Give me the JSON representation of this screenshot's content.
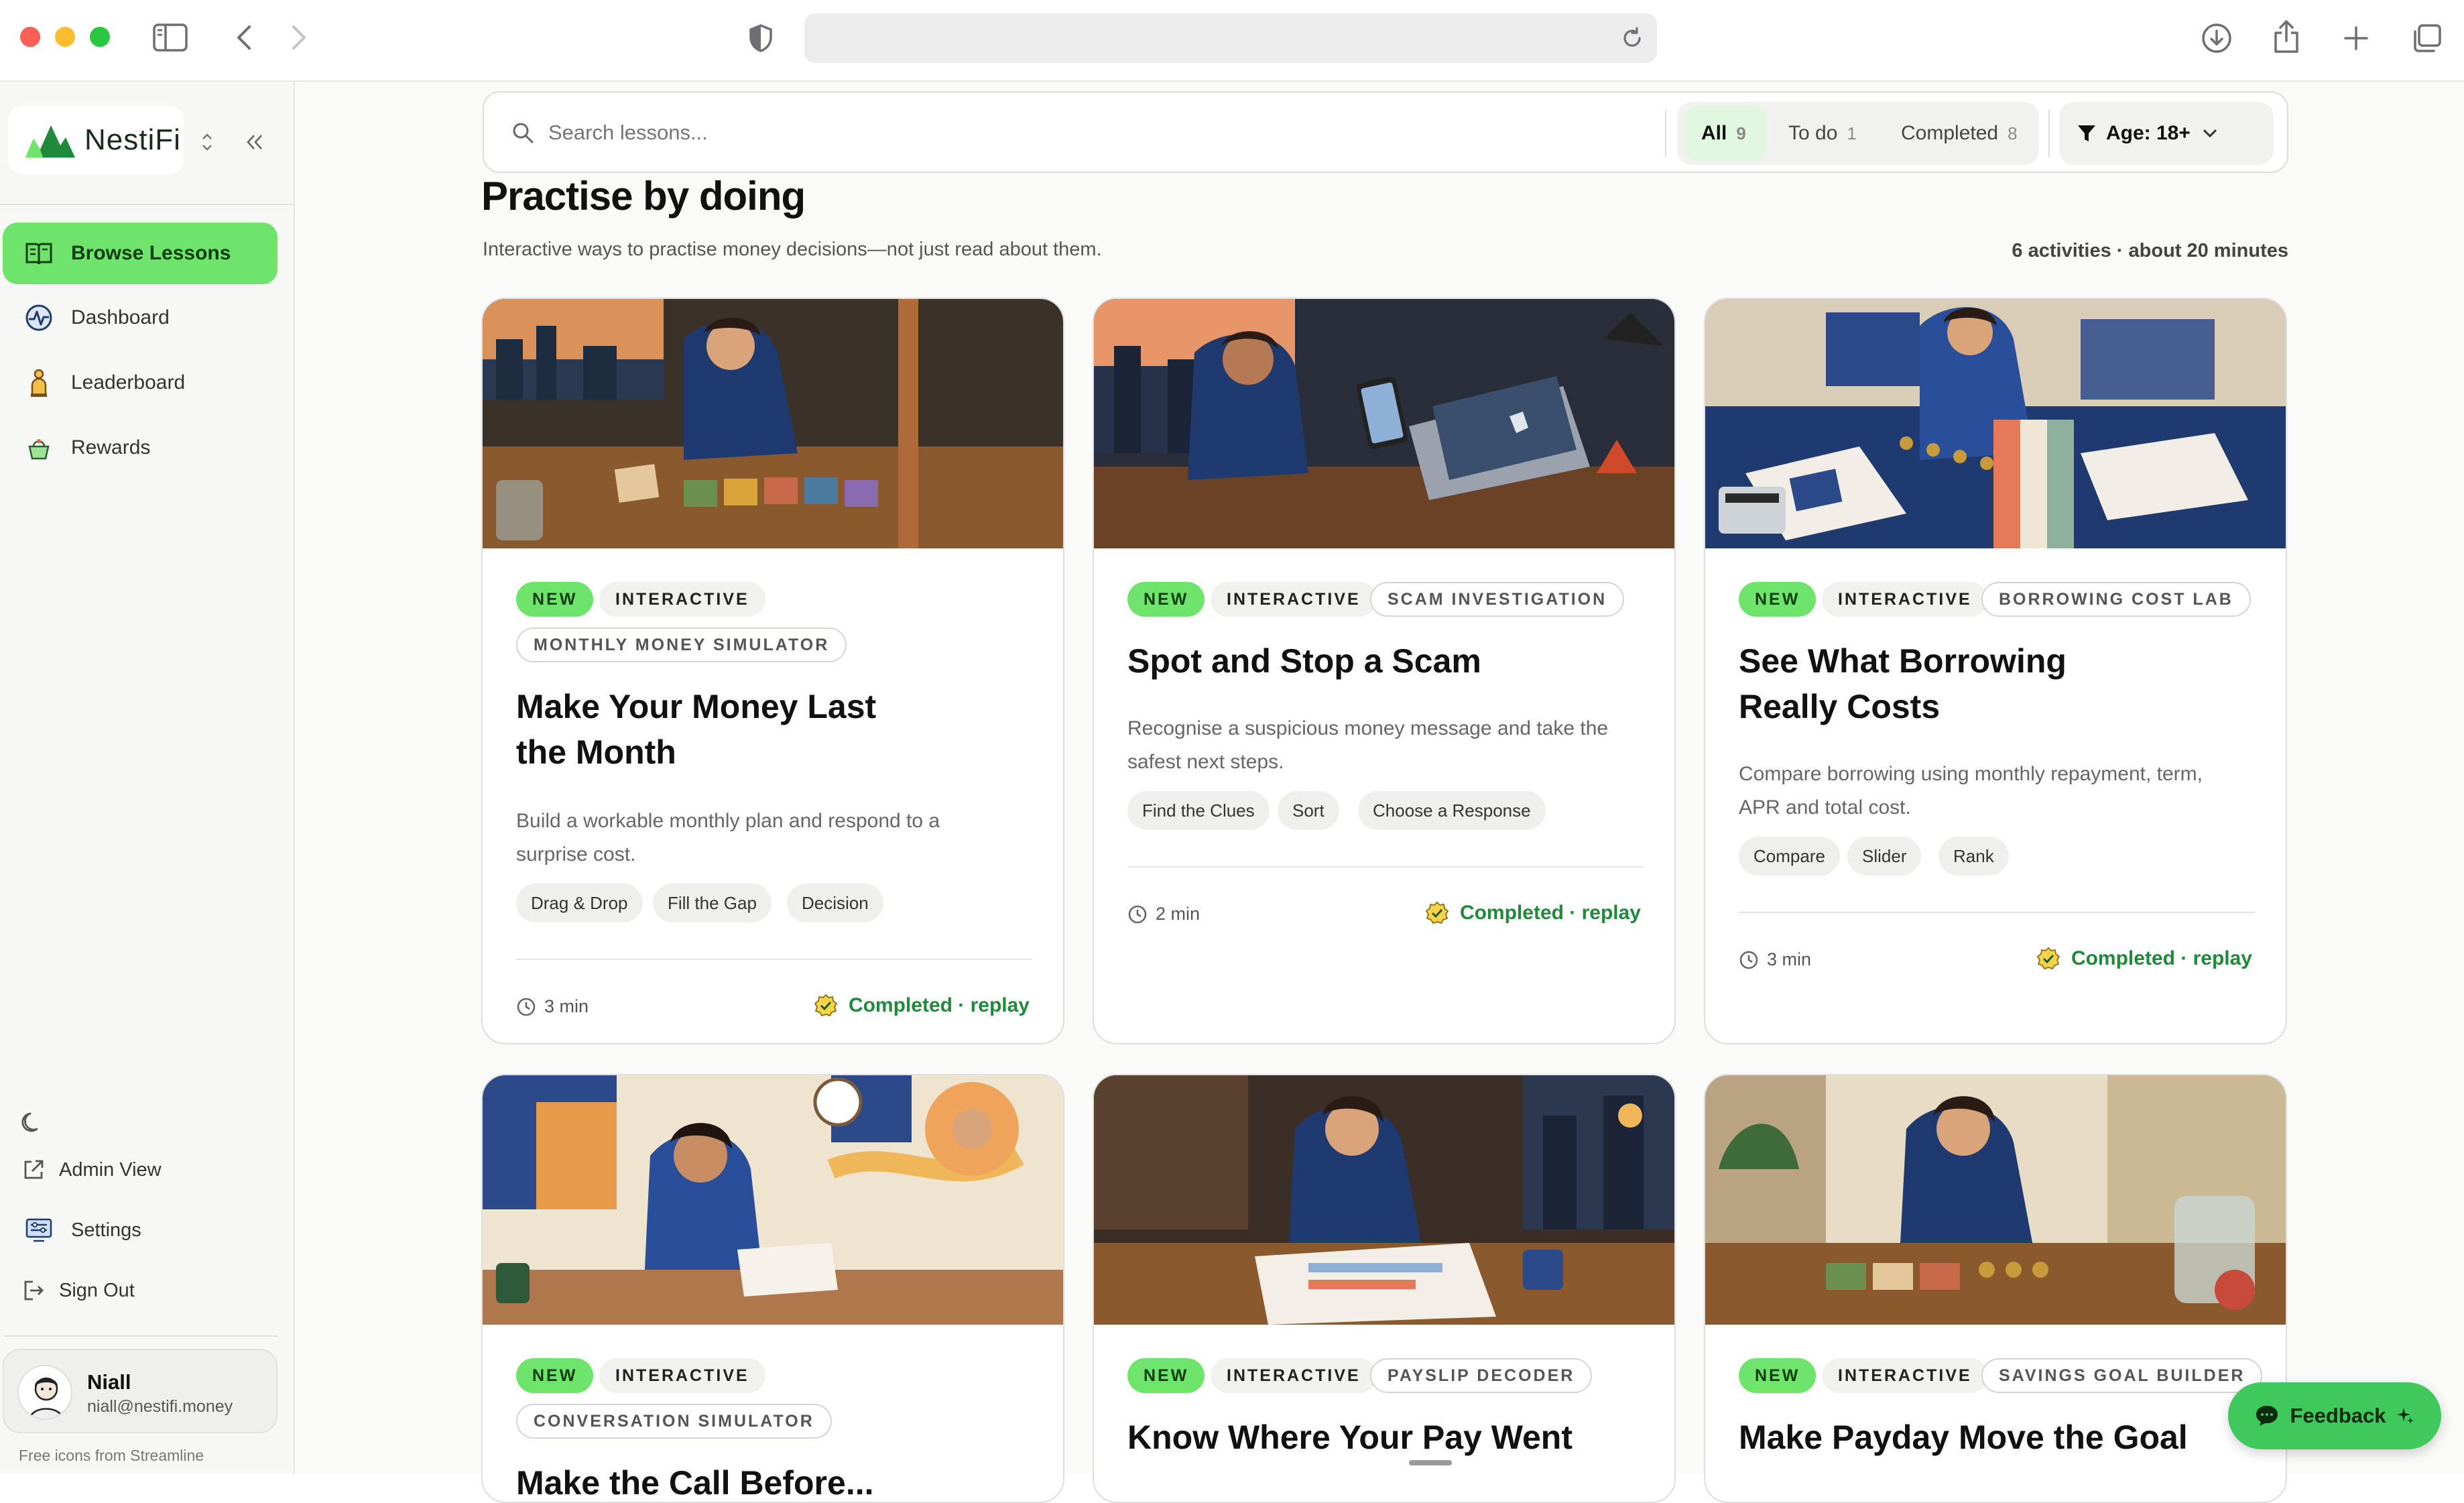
{
  "sidebar": {
    "brand": "NestiFi",
    "nav": [
      {
        "label": "Browse Lessons",
        "icon": "book-icon"
      },
      {
        "label": "Dashboard",
        "icon": "pulse-icon"
      },
      {
        "label": "Leaderboard",
        "icon": "trophy-person-icon"
      },
      {
        "label": "Rewards",
        "icon": "gift-basket-icon"
      }
    ],
    "bottom": {
      "admin": "Admin View",
      "settings": "Settings",
      "signout": "Sign Out"
    },
    "user": {
      "name": "Niall",
      "email": "niall@nestifi.money"
    },
    "credit": "Free icons from Streamline"
  },
  "toolbar": {
    "search_placeholder": "Search lessons...",
    "filters": [
      {
        "label": "All",
        "count": "9"
      },
      {
        "label": "To do",
        "count": "1"
      },
      {
        "label": "Completed",
        "count": "8"
      }
    ],
    "age": "Age: 18+"
  },
  "section": {
    "title": "Practise by doing",
    "subtitle": "Interactive ways to practise money decisions—not just read about them.",
    "meta": "6 activities · about 20 minutes"
  },
  "cards": [
    {
      "badges": [
        "NEW",
        "INTERACTIVE",
        "MONTHLY MONEY SIMULATOR"
      ],
      "title": "Make Your Money Last the Month",
      "description": "Build a workable monthly plan and respond to a surprise cost.",
      "tags": [
        "Drag & Drop",
        "Fill the Gap",
        "Decision"
      ],
      "duration": "3 min",
      "status": "Completed · replay"
    },
    {
      "badges": [
        "NEW",
        "INTERACTIVE",
        "SCAM INVESTIGATION"
      ],
      "title": "Spot and Stop a Scam",
      "description": "Recognise a suspicious money message and take the safest next steps.",
      "tags": [
        "Find the Clues",
        "Sort",
        "Choose a Response"
      ],
      "duration": "2 min",
      "status": "Completed · replay"
    },
    {
      "badges": [
        "NEW",
        "INTERACTIVE",
        "BORROWING COST LAB"
      ],
      "title": "See What Borrowing Really Costs",
      "description": "Compare borrowing using monthly repayment, term, APR and total cost.",
      "tags": [
        "Compare",
        "Slider",
        "Rank"
      ],
      "duration": "3 min",
      "status": "Completed · replay"
    },
    {
      "badges": [
        "NEW",
        "INTERACTIVE",
        "CONVERSATION SIMULATOR"
      ],
      "title": "Make the Call Before..."
    },
    {
      "badges": [
        "NEW",
        "INTERACTIVE",
        "PAYSLIP DECODER"
      ],
      "title": "Know Where Your Pay Went"
    },
    {
      "badges": [
        "NEW",
        "INTERACTIVE",
        "SAVINGS GOAL BUILDER"
      ],
      "title": "Make Payday Move the Goal"
    }
  ],
  "feedback": "Feedback",
  "colors": {
    "accent": "#6ee56a",
    "success": "#1f8a3a",
    "navy": "#1f3a6e"
  }
}
